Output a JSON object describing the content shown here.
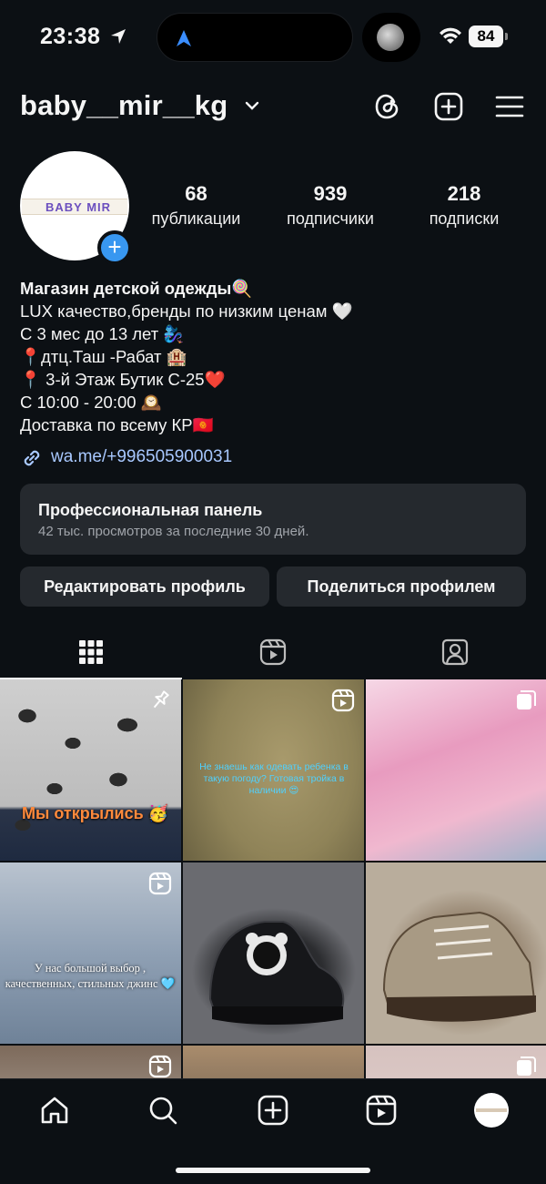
{
  "status_bar": {
    "time": "23:38",
    "battery": "84",
    "icons": [
      "location-arrow-icon",
      "navigation-icon",
      "wifi-icon",
      "battery-icon"
    ]
  },
  "header": {
    "username": "baby__mir__kg",
    "icons": [
      "chevron-down-icon",
      "threads-icon",
      "create-plus-icon",
      "menu-icon"
    ]
  },
  "profile": {
    "avatar_logo_text": "BABY MIR",
    "stats": [
      {
        "value": "68",
        "label": "публикации"
      },
      {
        "value": "939",
        "label": "подписчики"
      },
      {
        "value": "218",
        "label": "подписки"
      }
    ],
    "bio": {
      "name": "Магазин детской одежды🍭",
      "lines": [
        "LUX качество,бренды по низким ценам 🤍",
        "С 3 мес до 13 лет 🧞‍♀️",
        "📍дтц.Таш -Рабат 🏨",
        "📍 3-й Этаж Бутик С-25❤️",
        "С 10:00 - 20:00 🕰️",
        "Доставка по всему КР🇰🇬"
      ]
    },
    "link": "wa.me/+996505900031"
  },
  "professional_panel": {
    "title": "Профессиональная панель",
    "subtitle": "42 тыс. просмотров за последние 30 дней."
  },
  "buttons": {
    "edit": "Редактировать профиль",
    "share": "Поделиться профилем"
  },
  "tabs": [
    "grid-icon",
    "reels-icon",
    "tagged-icon"
  ],
  "grid": {
    "posts": [
      {
        "caption": "Мы открылись 🥳",
        "badge": "pin-icon"
      },
      {
        "caption": "Не знаешь как одевать ребенка в такую погоду? Готовая тройка в наличии 😍",
        "badge": "reels-icon"
      },
      {
        "caption": "",
        "badge": "carousel-icon"
      },
      {
        "caption": "У нас большой выбор , качественных, стильных джинс 🩵",
        "badge": "reels-icon"
      },
      {
        "caption": "",
        "badge": ""
      },
      {
        "caption": "",
        "badge": ""
      },
      {
        "caption": "",
        "badge": "reels-icon"
      },
      {
        "caption": "",
        "badge": ""
      },
      {
        "caption": "",
        "badge": "carousel-icon"
      }
    ]
  },
  "bottom_nav": [
    "home-icon",
    "search-icon",
    "create-icon",
    "reels-icon",
    "profile-avatar"
  ]
}
